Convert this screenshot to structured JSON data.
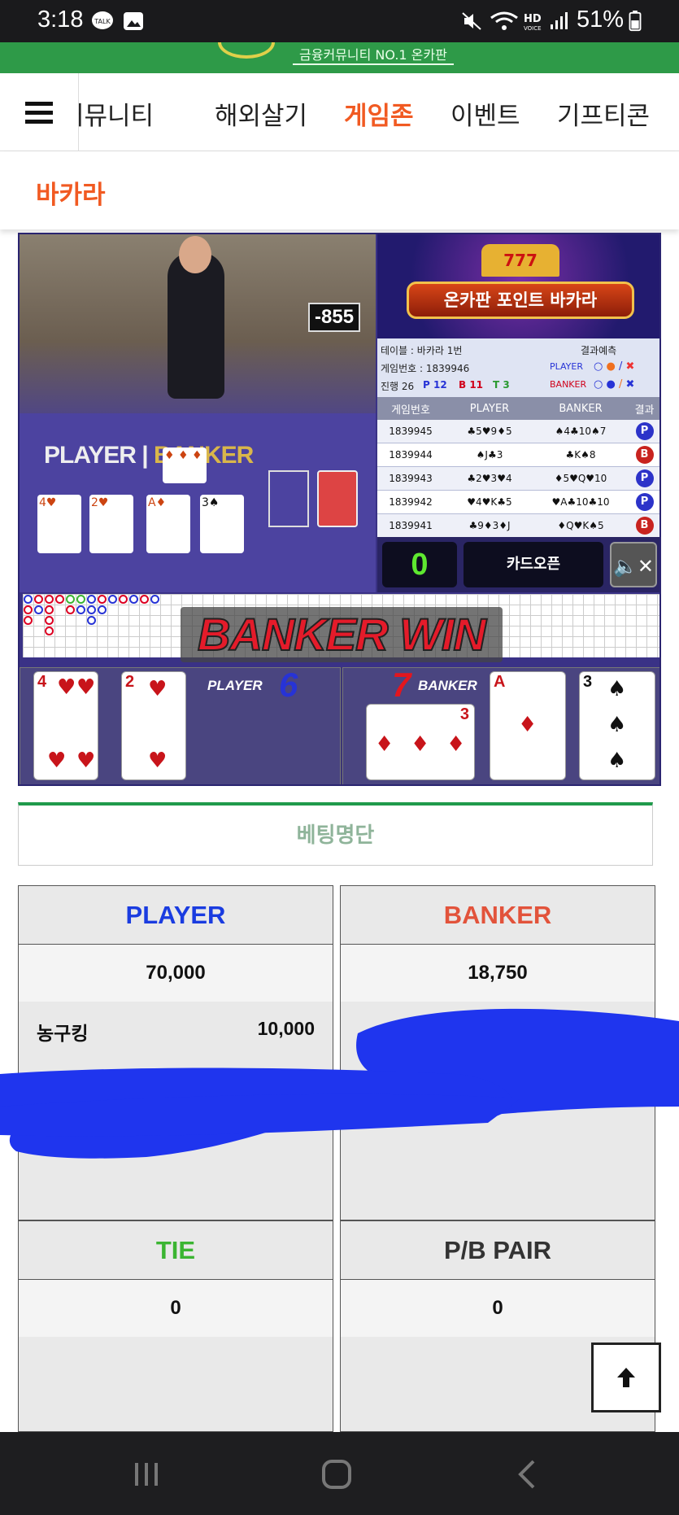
{
  "status_bar": {
    "time": "3:18",
    "battery": "51%"
  },
  "header": {
    "logo_text": "금융커뮤니티 NO.1 온카판"
  },
  "nav": {
    "items": [
      "커뮤니티",
      "해외살기",
      "게임존",
      "이벤트",
      "기프티콘"
    ],
    "active_index": 2
  },
  "page": {
    "title": "바카라"
  },
  "game": {
    "table_sign": "-855",
    "video_label_player": "PLAYER",
    "video_label_banker": "BANKER",
    "banner_title": "온카판 포인트 바카라",
    "banner_slot": "777",
    "info": {
      "table": "테이블 : 바카라 1번",
      "prediction": "결과예측",
      "game_no": "게임번호 : 1839946",
      "player": "PLAYER",
      "banker": "BANKER",
      "progress": "진행 26",
      "p_count": "P 12",
      "b_count": "B 11",
      "t_count": "T 3"
    },
    "history_headers": [
      "게임번호",
      "PLAYER",
      "BANKER",
      "결과"
    ],
    "history": [
      {
        "no": "1839945",
        "player": "♣5♥9♦5",
        "banker": "♠4♣10♠7",
        "result": "P"
      },
      {
        "no": "1839944",
        "player": "♠J♣3",
        "banker": "♣K♠8",
        "result": "B"
      },
      {
        "no": "1839943",
        "player": "♣2♥3♥4",
        "banker": "♦5♥Q♥10",
        "result": "P"
      },
      {
        "no": "1839942",
        "player": "♥4♥K♣5",
        "banker": "♥A♣10♣10",
        "result": "P"
      },
      {
        "no": "1839941",
        "player": "♣9♦3♦J",
        "banker": "♦Q♥K♠5",
        "result": "B"
      }
    ],
    "counter": "0",
    "card_open_label": "카드오픈",
    "win_text": "BANKER WIN",
    "player_label": "PLAYER",
    "player_score": "6",
    "banker_label": "BANKER",
    "banker_score": "7",
    "player_cards": [
      {
        "rank": "4",
        "suit": "♥"
      },
      {
        "rank": "2",
        "suit": "♥"
      }
    ],
    "banker_cards": [
      {
        "rank": "3",
        "suit": "♦"
      },
      {
        "rank": "A",
        "suit": "♦"
      },
      {
        "rank": "3",
        "suit": "♠"
      }
    ],
    "colors": {
      "player": "#2733d6",
      "banker": "#d0021b",
      "tie": "#3bb532"
    }
  },
  "bet_list": {
    "title": "베팅명단"
  },
  "panels": {
    "player": {
      "title": "PLAYER",
      "total": "70,000",
      "rows": [
        {
          "name": "농구킹",
          "amount": "10,000"
        }
      ]
    },
    "banker": {
      "title": "BANKER",
      "total": "18,750"
    },
    "tie": {
      "title": "TIE",
      "total": "0"
    },
    "pair": {
      "title": "P/B PAIR",
      "total": "0"
    }
  }
}
